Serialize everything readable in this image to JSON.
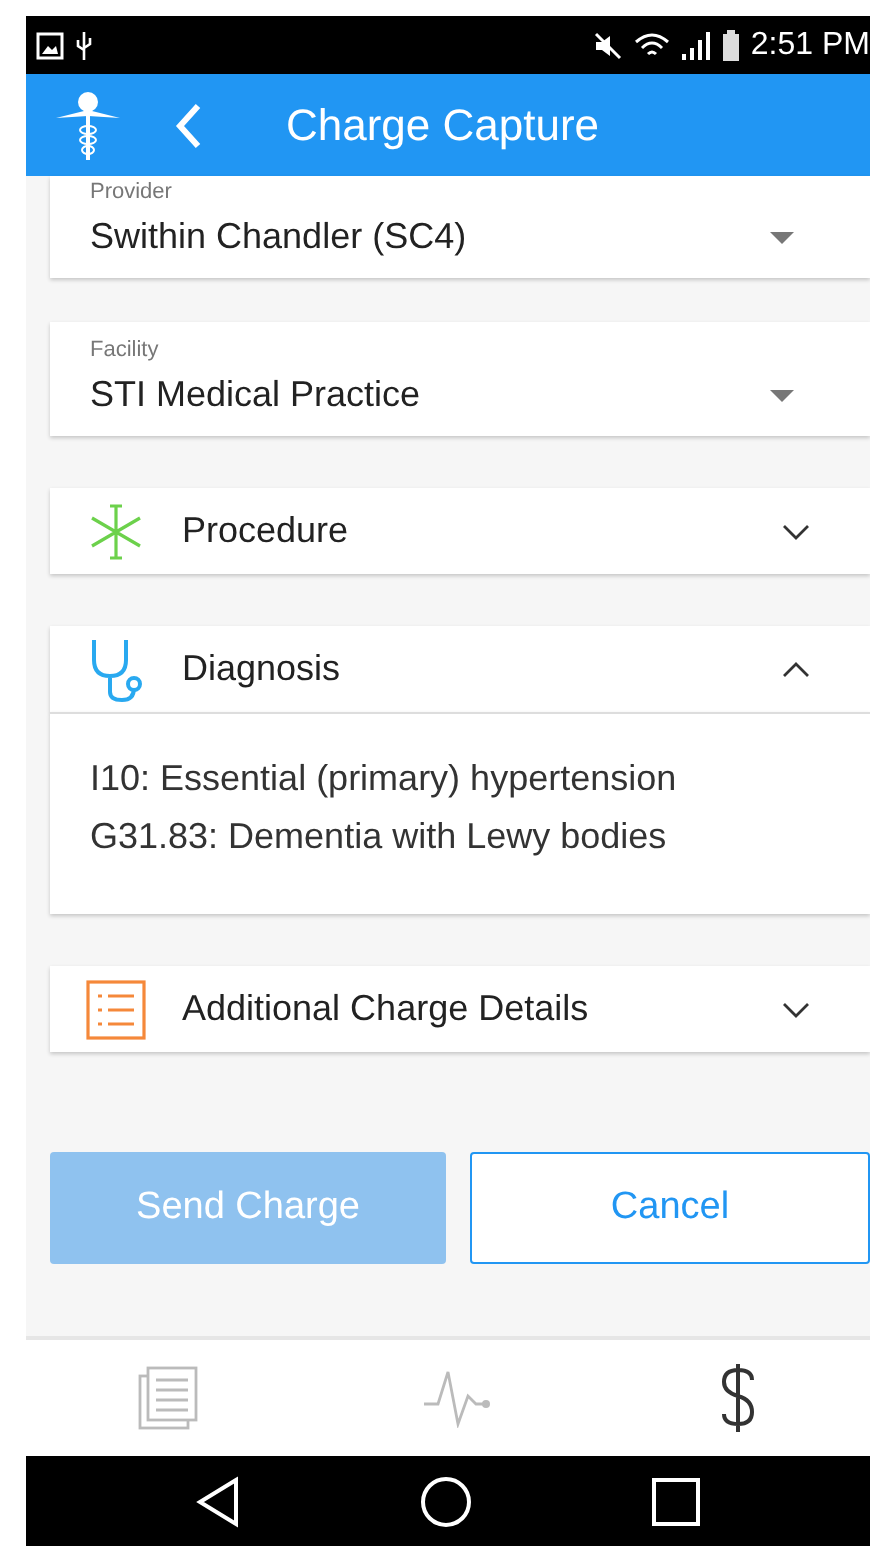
{
  "status_bar": {
    "time": "2:51 PM"
  },
  "app_bar": {
    "title": "Charge Capture"
  },
  "fields": [
    {
      "label": "Provider",
      "value": "Swithin Chandler (SC4)"
    },
    {
      "label": "Facility",
      "value": "STI Medical Practice"
    }
  ],
  "sections": [
    {
      "kind": "procedure",
      "title": "Procedure",
      "expanded": false
    },
    {
      "kind": "diagnosis",
      "title": "Diagnosis",
      "expanded": true,
      "items": [
        "I10: Essential (primary) hypertension",
        "G31.83: Dementia with Lewy bodies"
      ]
    },
    {
      "kind": "details",
      "title": "Additional Charge Details",
      "expanded": false
    }
  ],
  "buttons": [
    {
      "label": "Send Charge",
      "kind": "primary",
      "disabled": true
    },
    {
      "label": "Cancel",
      "kind": "outline",
      "disabled": false
    }
  ],
  "bottom_nav": [
    {
      "selected": false
    },
    {
      "selected": false
    },
    {
      "selected": true
    }
  ]
}
